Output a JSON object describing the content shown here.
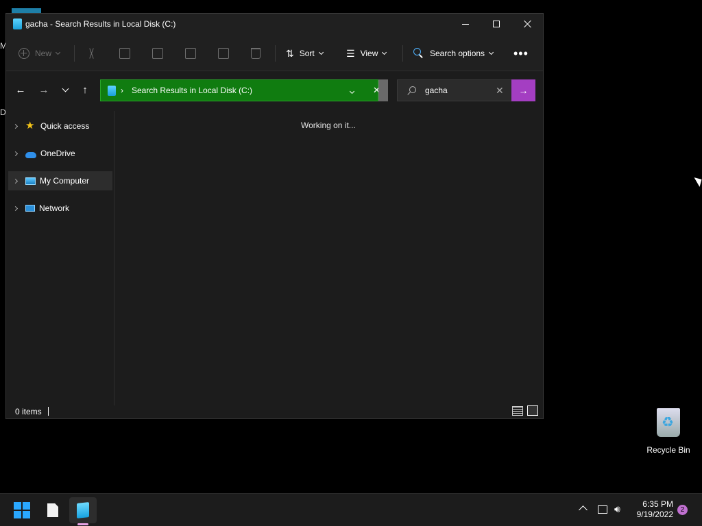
{
  "window": {
    "title": "gacha - Search Results in Local Disk (C:)"
  },
  "commandbar": {
    "new_label": "New",
    "sort_label": "Sort",
    "view_label": "View",
    "search_options_label": "Search options",
    "more_label": "•••"
  },
  "address": {
    "separator": "›",
    "path": "Search Results in Local Disk (C:)"
  },
  "search": {
    "value": "gacha"
  },
  "navpane": {
    "items": [
      {
        "label": "Quick access",
        "icon": "star-icon"
      },
      {
        "label": "OneDrive",
        "icon": "cloud-icon"
      },
      {
        "label": "My Computer",
        "icon": "computer-icon",
        "selected": true
      },
      {
        "label": "Network",
        "icon": "network-icon"
      }
    ]
  },
  "content": {
    "status": "Working on it..."
  },
  "statusbar": {
    "item_count": "0 items"
  },
  "desktop": {
    "recycle_bin_label": "Recycle Bin",
    "left_letter_1": "M",
    "left_letter_2": "D"
  },
  "taskbar": {
    "time": "6:35 PM",
    "date": "9/19/2022",
    "notification_count": "2"
  },
  "colors": {
    "address_bg": "#107c10",
    "search_go": "#a43ec2",
    "accent_blue": "#2aa8ff"
  }
}
